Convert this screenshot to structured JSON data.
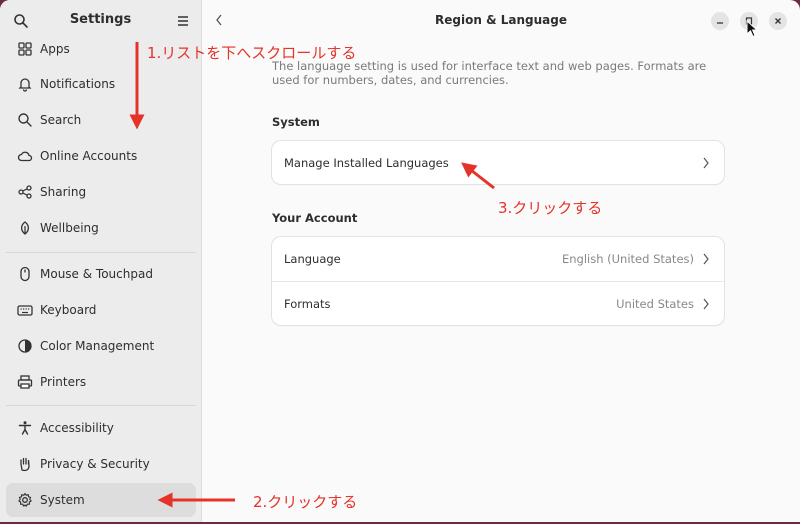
{
  "sidebar": {
    "title": "Settings",
    "search_icon": "search-icon",
    "menu_icon": "hamburger-menu-icon",
    "items": [
      {
        "label": "Apps",
        "icon": "apps-icon"
      },
      {
        "label": "Notifications",
        "icon": "bell-icon"
      },
      {
        "label": "Search",
        "icon": "search-icon"
      },
      {
        "label": "Online Accounts",
        "icon": "cloud-icon"
      },
      {
        "label": "Sharing",
        "icon": "share-icon"
      },
      {
        "label": "Wellbeing",
        "icon": "wellbeing-icon"
      },
      {
        "label": "Mouse & Touchpad",
        "icon": "mouse-icon"
      },
      {
        "label": "Keyboard",
        "icon": "keyboard-icon"
      },
      {
        "label": "Color Management",
        "icon": "color-icon"
      },
      {
        "label": "Printers",
        "icon": "printer-icon"
      },
      {
        "label": "Accessibility",
        "icon": "accessibility-icon"
      },
      {
        "label": "Privacy & Security",
        "icon": "hand-icon"
      },
      {
        "label": "System",
        "icon": "gear-icon",
        "selected": true
      }
    ]
  },
  "main": {
    "title": "Region & Language",
    "description": "The language setting is used for interface text and web pages. Formats are used for numbers, dates, and currencies.",
    "system_section": {
      "title": "System",
      "rows": [
        {
          "label": "Manage Installed Languages"
        }
      ]
    },
    "account_section": {
      "title": "Your Account",
      "rows": [
        {
          "label": "Language",
          "value": "English (United States)"
        },
        {
          "label": "Formats",
          "value": "United States"
        }
      ]
    }
  },
  "annotations": {
    "step1": "1.リストを下へスクロールする",
    "step2": "2.クリックする",
    "step3": "3.クリックする",
    "color": "#e5332a"
  },
  "colors": {
    "selected_bg": "#dddddd",
    "sidebar_bg": "#ececec",
    "content_bg": "#fafafa"
  }
}
